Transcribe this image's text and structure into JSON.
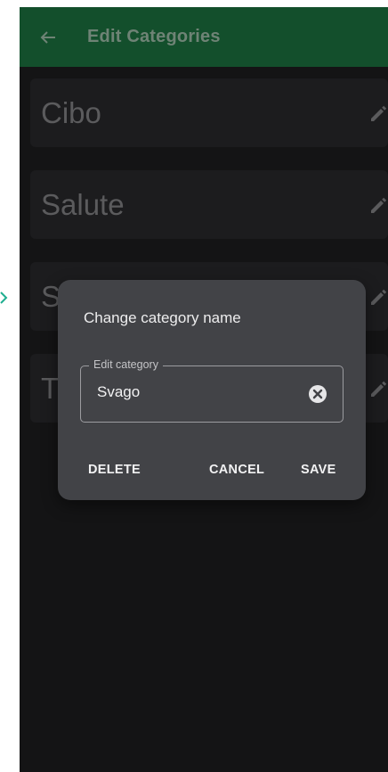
{
  "appbar": {
    "title": "Edit Categories",
    "back_icon": "arrow-back-icon",
    "color": "#1e7a44"
  },
  "categories": [
    {
      "label": "Cibo",
      "icon": "pencil-icon"
    },
    {
      "label": "Salute",
      "icon": "pencil-icon"
    },
    {
      "label": "S",
      "icon": "pencil-icon"
    },
    {
      "label": "T",
      "icon": "pencil-icon"
    }
  ],
  "dialog": {
    "title": "Change category name",
    "field_label": "Edit category",
    "field_value": "Svago",
    "clear_icon": "clear-circle-icon",
    "buttons": {
      "delete": "DELETE",
      "cancel": "CANCEL",
      "save": "SAVE"
    }
  },
  "colors": {
    "background": "#1f1f21",
    "item": "#2b2b2e",
    "dialog": "#424347",
    "accent_mark": "#1fae8f"
  }
}
